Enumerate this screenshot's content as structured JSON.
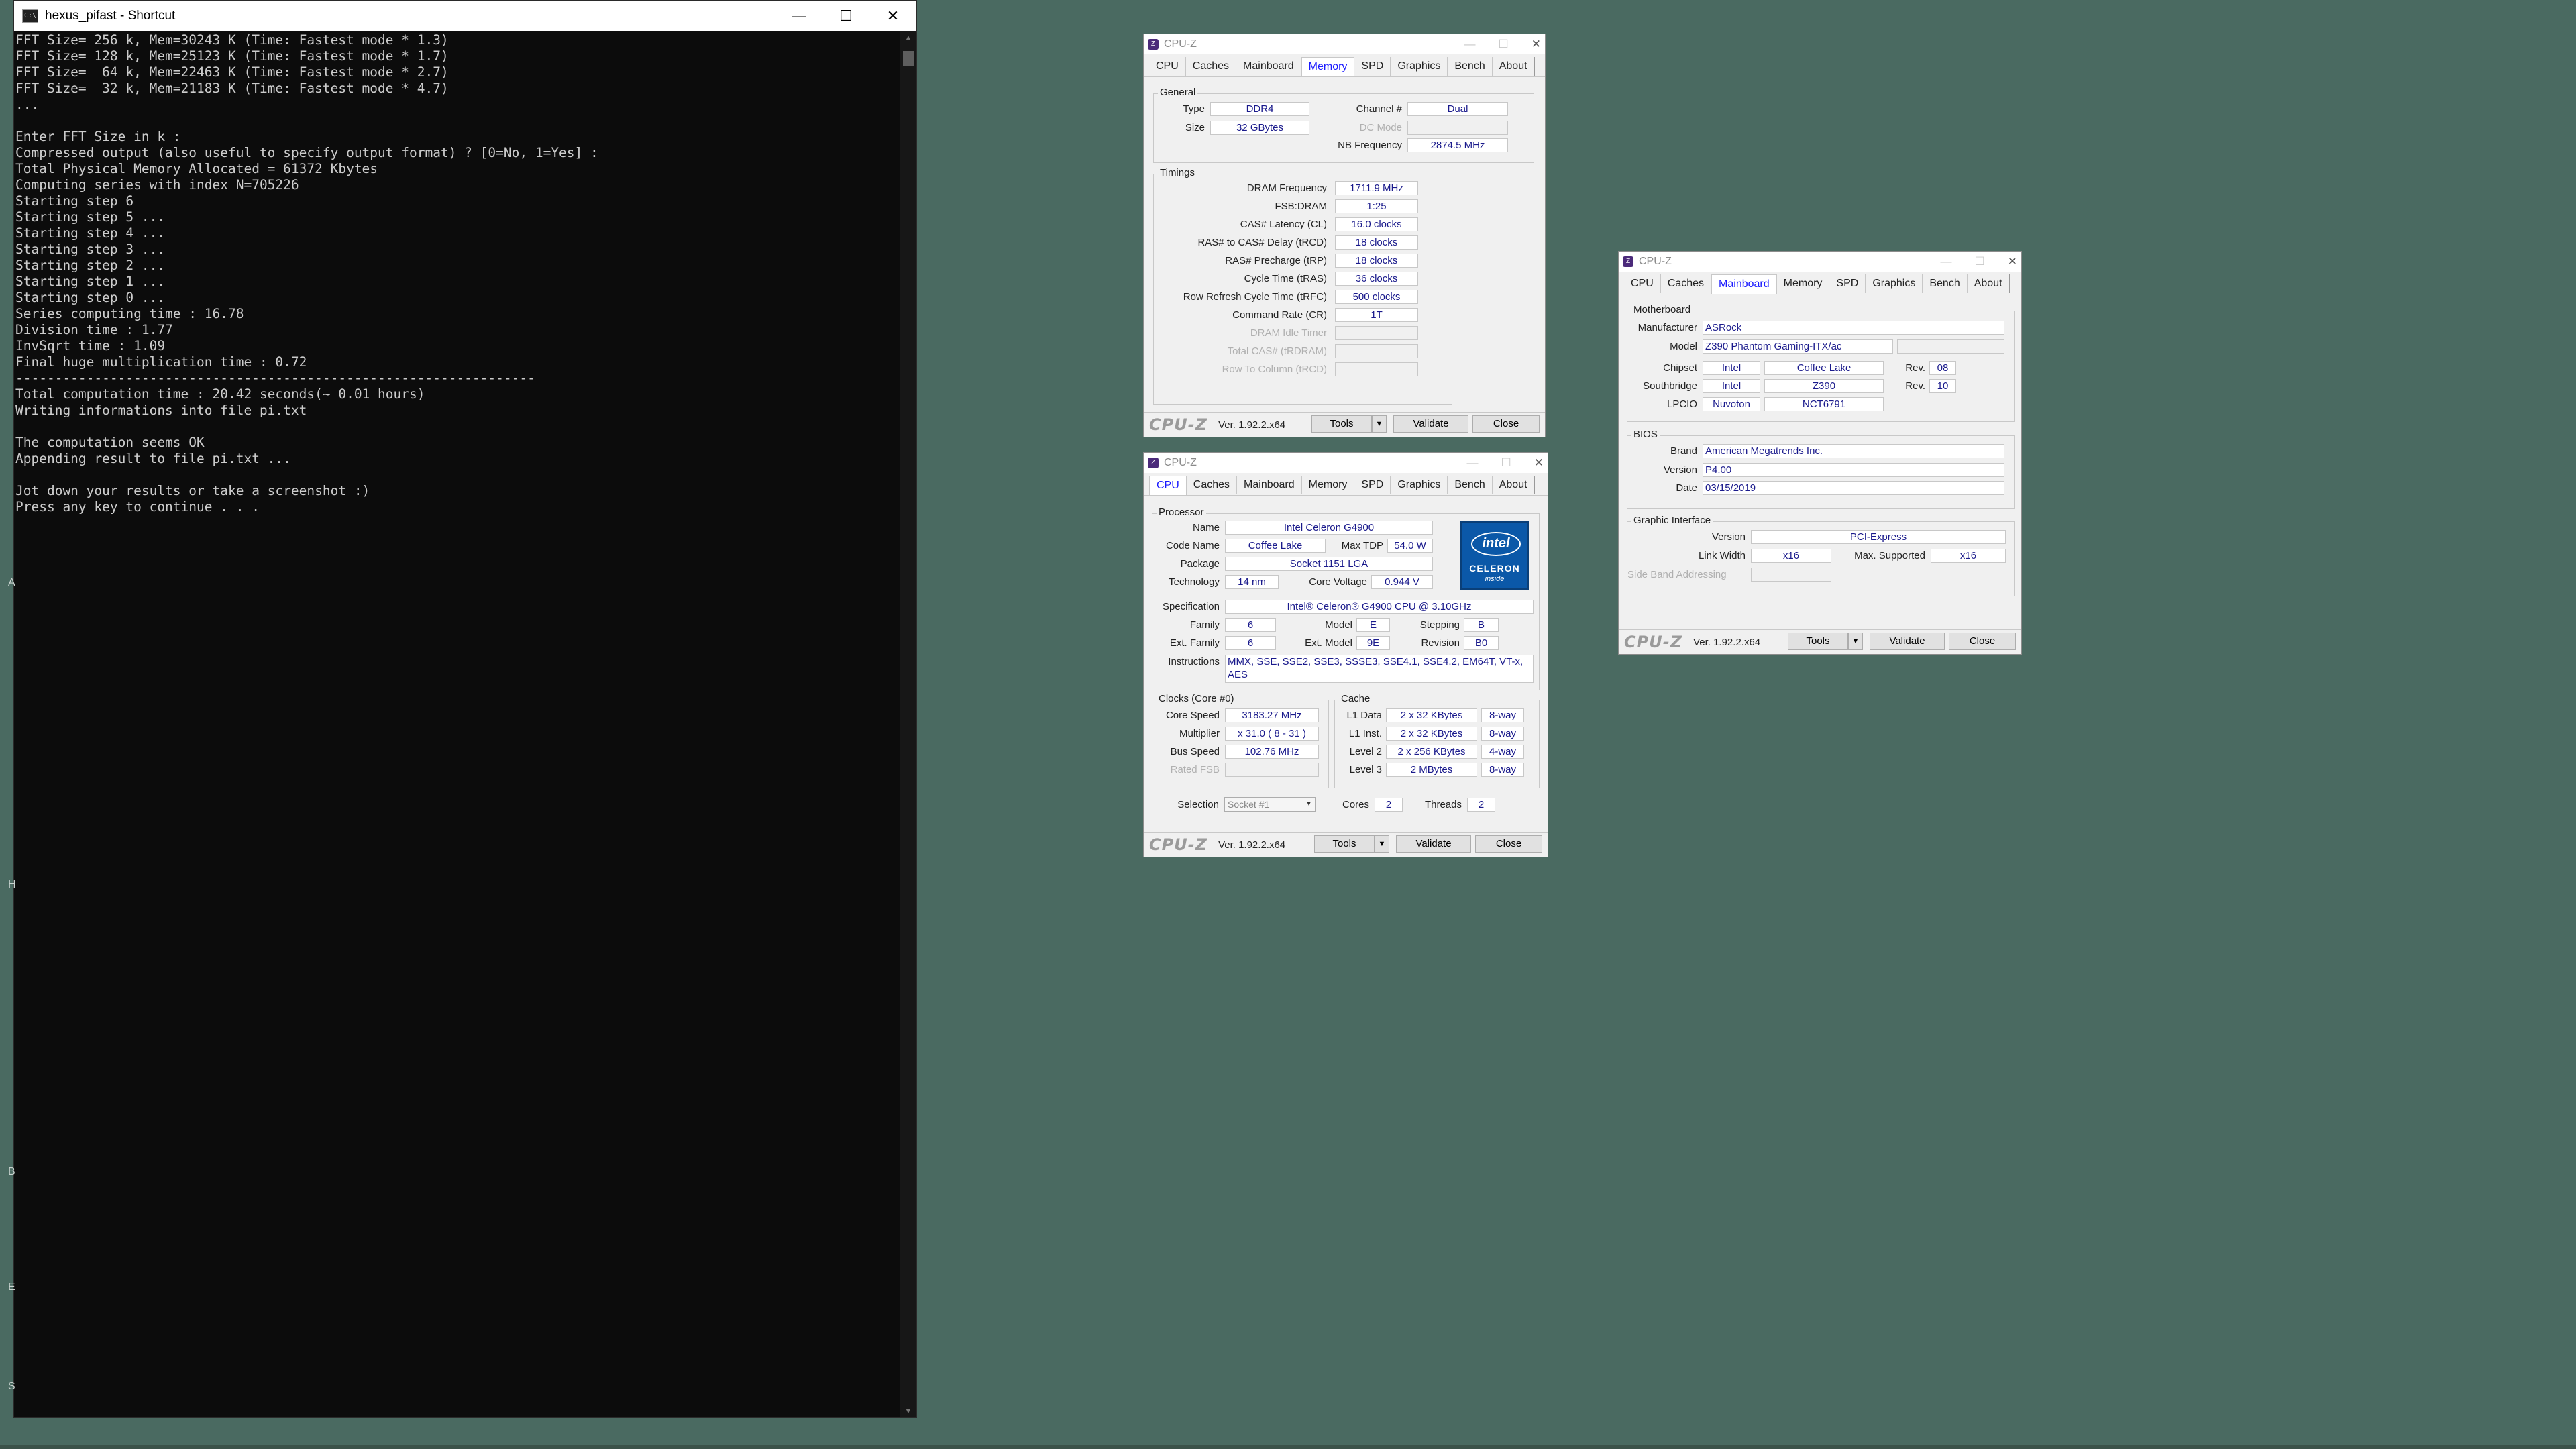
{
  "console": {
    "title": "hexus_pifast - Shortcut",
    "window_buttons": {
      "minimize": "—",
      "maximize": "☐",
      "close": "✕"
    },
    "lines": [
      "FFT Size= 256 k, Mem=30243 K (Time: Fastest mode * 1.3)",
      "FFT Size= 128 k, Mem=25123 K (Time: Fastest mode * 1.7)",
      "FFT Size=  64 k, Mem=22463 K (Time: Fastest mode * 2.7)",
      "FFT Size=  32 k, Mem=21183 K (Time: Fastest mode * 4.7)",
      "...",
      "",
      "Enter FFT Size in k :",
      "Compressed output (also useful to specify output format) ? [0=No, 1=Yes] :",
      "Total Physical Memory Allocated = 61372 Kbytes",
      "Computing series with index N=705226",
      "Starting step 6",
      "Starting step 5 ...",
      "Starting step 4 ...",
      "Starting step 3 ...",
      "Starting step 2 ...",
      "Starting step 1 ...",
      "Starting step 0 ...",
      "Series computing time : 16.78",
      "Division time : 1.77",
      "InvSqrt time : 1.09",
      "Final huge multiplication time : 0.72",
      "------------------------------------------------------------------",
      "Total computation time : 20.42 seconds(~ 0.01 hours)",
      "Writing informations into file pi.txt",
      "",
      "The computation seems OK",
      "Appending result to file pi.txt ...",
      "",
      "Jot down your results or take a screenshot :)",
      "Press any key to continue . . ."
    ]
  },
  "edge_marks": [
    "A",
    "H",
    "B",
    "E",
    "S"
  ],
  "cpuz_common": {
    "title": "CPU-Z",
    "tabs": [
      "CPU",
      "Caches",
      "Mainboard",
      "Memory",
      "SPD",
      "Graphics",
      "Bench",
      "About"
    ],
    "brand": "CPU-Z",
    "version": "Ver. 1.92.2.x64",
    "tools_label": "Tools",
    "validate_label": "Validate",
    "close_label": "Close"
  },
  "memory": {
    "active_tab": "Memory",
    "general_legend": "General",
    "type_label": "Type",
    "type": "DDR4",
    "size_label": "Size",
    "size": "32 GBytes",
    "channel_label": "Channel #",
    "channel": "Dual",
    "dc_mode_label": "DC Mode",
    "dc_mode": "",
    "nb_freq_label": "NB Frequency",
    "nb_freq": "2874.5 MHz",
    "timings_legend": "Timings",
    "timings": [
      {
        "label": "DRAM Frequency",
        "value": "1711.9 MHz",
        "dim": false
      },
      {
        "label": "FSB:DRAM",
        "value": "1:25",
        "dim": false
      },
      {
        "label": "CAS# Latency (CL)",
        "value": "16.0 clocks",
        "dim": false
      },
      {
        "label": "RAS# to CAS# Delay (tRCD)",
        "value": "18 clocks",
        "dim": false
      },
      {
        "label": "RAS# Precharge (tRP)",
        "value": "18 clocks",
        "dim": false
      },
      {
        "label": "Cycle Time (tRAS)",
        "value": "36 clocks",
        "dim": false
      },
      {
        "label": "Row Refresh Cycle Time (tRFC)",
        "value": "500 clocks",
        "dim": false
      },
      {
        "label": "Command Rate (CR)",
        "value": "1T",
        "dim": false
      },
      {
        "label": "DRAM Idle Timer",
        "value": "",
        "dim": true
      },
      {
        "label": "Total CAS# (tRDRAM)",
        "value": "",
        "dim": true
      },
      {
        "label": "Row To Column (tRCD)",
        "value": "",
        "dim": true
      }
    ]
  },
  "cpu": {
    "active_tab": "CPU",
    "processor_legend": "Processor",
    "name_label": "Name",
    "name": "Intel Celeron G4900",
    "codename_label": "Code Name",
    "codename": "Coffee Lake",
    "maxtdp_label": "Max TDP",
    "maxtdp": "54.0 W",
    "package_label": "Package",
    "package": "Socket 1151 LGA",
    "tech_label": "Technology",
    "tech": "14 nm",
    "voltage_label": "Core Voltage",
    "voltage": "0.944 V",
    "spec_label": "Specification",
    "spec": "Intel® Celeron® G4900 CPU @ 3.10GHz",
    "family_label": "Family",
    "family": "6",
    "model_label": "Model",
    "model": "E",
    "stepping_label": "Stepping",
    "stepping": "B",
    "extfamily_label": "Ext. Family",
    "extfamily": "6",
    "extmodel_label": "Ext. Model",
    "extmodel": "9E",
    "revision_label": "Revision",
    "revision": "B0",
    "instr_label": "Instructions",
    "instr": "MMX, SSE, SSE2, SSE3, SSSE3, SSE4.1, SSE4.2, EM64T, VT-x, AES",
    "logo": {
      "brand": "intel",
      "product": "CELERON",
      "tag": "inside"
    },
    "clocks_legend": "Clocks (Core #0)",
    "corespeed_label": "Core Speed",
    "corespeed": "3183.27 MHz",
    "mult_label": "Multiplier",
    "mult": "x 31.0 ( 8 - 31 )",
    "bus_label": "Bus Speed",
    "bus": "102.76 MHz",
    "ratedfsb_label": "Rated FSB",
    "ratedfsb": "",
    "cache_legend": "Cache",
    "cache": [
      {
        "label": "L1 Data",
        "size": "2 x 32 KBytes",
        "way": "8-way"
      },
      {
        "label": "L1 Inst.",
        "size": "2 x 32 KBytes",
        "way": "8-way"
      },
      {
        "label": "Level 2",
        "size": "2 x 256 KBytes",
        "way": "4-way"
      },
      {
        "label": "Level 3",
        "size": "2 MBytes",
        "way": "8-way"
      }
    ],
    "selection_label": "Selection",
    "selection": "Socket #1",
    "cores_label": "Cores",
    "cores": "2",
    "threads_label": "Threads",
    "threads": "2"
  },
  "mainboard": {
    "active_tab": "Mainboard",
    "mb_legend": "Motherboard",
    "manufacturer_label": "Manufacturer",
    "manufacturer": "ASRock",
    "model_label": "Model",
    "model": "Z390 Phantom Gaming-ITX/ac",
    "model_extra": "",
    "chipset_label": "Chipset",
    "chipset_vendor": "Intel",
    "chipset_name": "Coffee Lake",
    "chipset_rev_label": "Rev.",
    "chipset_rev": "08",
    "south_label": "Southbridge",
    "south_vendor": "Intel",
    "south_name": "Z390",
    "south_rev_label": "Rev.",
    "south_rev": "10",
    "lpcio_label": "LPCIO",
    "lpcio_vendor": "Nuvoton",
    "lpcio_name": "NCT6791",
    "bios_legend": "BIOS",
    "brand_label": "Brand",
    "brand": "American Megatrends Inc.",
    "version_label": "Version",
    "version": "P4.00",
    "date_label": "Date",
    "date": "03/15/2019",
    "gi_legend": "Graphic Interface",
    "gi_version_label": "Version",
    "gi_version": "PCI-Express",
    "linkwidth_label": "Link Width",
    "linkwidth": "x16",
    "maxsup_label": "Max. Supported",
    "maxsup": "x16",
    "sideband_label": "Side Band Addressing",
    "sideband": ""
  }
}
